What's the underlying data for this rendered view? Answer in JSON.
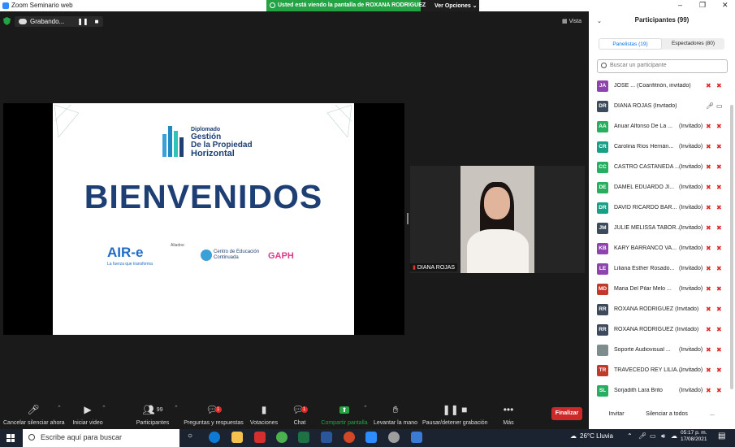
{
  "window": {
    "title": "Zoom Seminario web",
    "minimize": "–",
    "maximize": "❐",
    "close": "✕"
  },
  "share_banner": {
    "text": "Usted está viendo la pantalla de  ROXANA RODRIGUEZ",
    "options": "Ver Opciones ⌄"
  },
  "meeting": {
    "recording_label": "Grabando...",
    "pause_glyph": "❚❚",
    "stop_glyph": "■",
    "view_label": "Vista",
    "slide": {
      "program_line1": "Diplomado",
      "program_line2": "Gestión",
      "program_line3": "De la Propiedad",
      "program_line4": "Horizontal",
      "heading": "BIENVENIDOS",
      "aire_logo": "AIR-e",
      "aire_tagline": "La fuerza que transforma",
      "aliados": "Aliados:",
      "centro": "Centro de Educación Continuada",
      "gaph": "GAPH"
    },
    "video_name": "DIANA ROJAS"
  },
  "toolbar": {
    "items": [
      {
        "label": "Cancelar silenciar ahora",
        "icon": "mic-muted-icon"
      },
      {
        "label": "Iniciar video",
        "icon": "video-off-icon"
      },
      {
        "label": "Participantes",
        "icon": "participants-icon",
        "count": "99"
      },
      {
        "label": "Preguntas y respuestas",
        "icon": "qa-icon",
        "badge": "1"
      },
      {
        "label": "Votaciones",
        "icon": "polls-icon"
      },
      {
        "label": "Chat",
        "icon": "chat-icon",
        "badge": "1"
      },
      {
        "label": "Compartir pantalla",
        "icon": "share-screen-icon"
      },
      {
        "label": "Levantar la mano",
        "icon": "raise-hand-icon"
      },
      {
        "label": "Pausar/detener grabación",
        "icon": "record-icon"
      },
      {
        "label": "Más",
        "icon": "more-icon"
      }
    ],
    "end_label": "Finalizar"
  },
  "participants": {
    "title": "Participantes (99)",
    "tab_panelists": "Panelistas (19)",
    "tab_attendees": "Espectadores (80)",
    "search_placeholder": "Buscar un participante",
    "list": [
      {
        "initials": "JA",
        "name": "JOSE ... (Coanfitrión, invitado)",
        "tag": "",
        "color": "#8e44ad"
      },
      {
        "initials": "DR",
        "name": "DIANA ROJAS (Invitado)",
        "tag": "",
        "color": "#3d4a5c"
      },
      {
        "initials": "AA",
        "name": "Anuar Alfonso De La ...",
        "tag": "(Invitado)",
        "color": "#27ae60"
      },
      {
        "initials": "CR",
        "name": "Carolina Ríos Hernán...",
        "tag": "(Invitado)",
        "color": "#16a085"
      },
      {
        "initials": "CC",
        "name": "CASTRO CASTAÑEDA ...",
        "tag": "(Invitado)",
        "color": "#27ae60"
      },
      {
        "initials": "DE",
        "name": "DAMEL EDUARDO JI...",
        "tag": "(Invitado)",
        "color": "#27ae60"
      },
      {
        "initials": "DR",
        "name": "DAVID RICARDO BAR...",
        "tag": "(Invitado)",
        "color": "#16a085"
      },
      {
        "initials": "JM",
        "name": "JULIE MELISSA TABOR...",
        "tag": "(Invitado)",
        "color": "#3d4a5c"
      },
      {
        "initials": "KB",
        "name": "KARY BARRANCO VA...",
        "tag": "(Invitado)",
        "color": "#8e44ad"
      },
      {
        "initials": "LE",
        "name": "Liliana Esther Rosado...",
        "tag": "(Invitado)",
        "color": "#8e44ad"
      },
      {
        "initials": "MD",
        "name": "Maria Del Pilar Melo ...",
        "tag": "(Invitado)",
        "color": "#c0392b"
      },
      {
        "initials": "RR",
        "name": "ROXANA RODRIGUEZ (Invitado)",
        "tag": "",
        "color": "#3d4a5c"
      },
      {
        "initials": "RR",
        "name": "ROXANA RODRIGUEZ (Invitado)",
        "tag": "",
        "color": "#3d4a5c"
      },
      {
        "initials": "",
        "name": "Soporte Audiovisual ...",
        "tag": "(Invitado)",
        "color": "#7f8c8d"
      },
      {
        "initials": "TR",
        "name": "TRAVECEDO REY LILIA...",
        "tag": "(Invitado)",
        "color": "#c0392b"
      },
      {
        "initials": "SL",
        "name": "Sorjadith Lara Brito",
        "tag": "(Invitado)",
        "color": "#27ae60"
      }
    ],
    "btn_invite": "Invitar",
    "btn_mute_all": "Silenciar a todos",
    "btn_more": "..."
  },
  "taskbar": {
    "search_placeholder": "Escribe aquí para buscar",
    "weather": "26°C  Lluvia",
    "time": "05:17 p. m.",
    "date": "17/08/2021"
  }
}
